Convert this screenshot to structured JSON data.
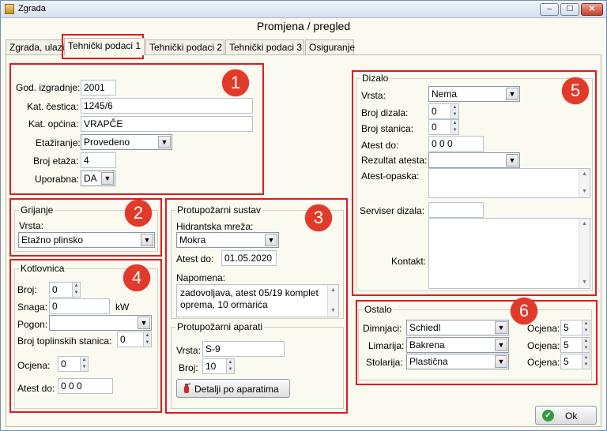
{
  "window": {
    "title": "Zgrada",
    "min": "‒",
    "max": "☐",
    "close": "✕"
  },
  "header": {
    "title": "Promjena / pregled"
  },
  "tabs": [
    "Zgrada, ulazi",
    "Tehnički podaci 1",
    "Tehnički podaci 2",
    "Tehnički podaci 3",
    "Osiguranje"
  ],
  "badges": [
    "1",
    "2",
    "3",
    "4",
    "5",
    "6"
  ],
  "section1": {
    "god_izgradnje_label": "God. izgradnje:",
    "god_izgradnje": "2001",
    "kat_cestica_label": "Kat. čestica:",
    "kat_cestica": "1245/6",
    "kat_opcina_label": "Kat. općina:",
    "kat_opcina": "VRAPČE",
    "etaziranje_label": "Etažiranje:",
    "etaziranje": "Provedeno",
    "broj_etaza_label": "Broj etaža:",
    "broj_etaza": "4",
    "uporabna_label": "Uporabna:",
    "uporabna": "DA"
  },
  "grijanje": {
    "title": "Grijanje",
    "vrsta_label": "Vrsta:",
    "vrsta": "Etažno plinsko"
  },
  "kotlovnica": {
    "title": "Kotlovnica",
    "broj_label": "Broj:",
    "broj": "0",
    "snaga_label": "Snaga:",
    "snaga": "0",
    "snaga_unit": "kW",
    "pogon_label": "Pogon:",
    "pogon": "",
    "broj_stanica_label": "Broj toplinskih stanica:",
    "broj_stanica": "0",
    "ocjena_label": "Ocjena:",
    "ocjena": "0",
    "atest_label": "Atest do:",
    "atest": "0 0 0"
  },
  "protupozarni": {
    "title": "Protupožarni sustav",
    "hidrantska_label": "Hidrantska mreža:",
    "hidrantska": "Mokra",
    "atest_label": "Atest do:",
    "atest": "01.05.2020",
    "napomena_label": "Napomena:",
    "napomena": "zadovoljava, atest 05/19 komplet oprema, 10 ormarića",
    "aparati_title": "Protupožarni aparati",
    "vrsta_label": "Vrsta:",
    "vrsta": "S-9",
    "broj_label": "Broj:",
    "broj": "10",
    "detalji_button": "Detalji po aparatima"
  },
  "dizalo": {
    "title": "Dizalo",
    "vrsta_label": "Vrsta:",
    "vrsta": "Nema",
    "broj_dizala_label": "Broj dizala:",
    "broj_dizala": "0",
    "broj_stanica_label": "Broj stanica:",
    "broj_stanica": "0",
    "atest_label": "Atest do:",
    "atest": "0 0 0",
    "rezultat_label": "Rezultat atesta:",
    "rezultat": "",
    "atest_opaska_label": "Atest-opaska:",
    "atest_opaska": "",
    "serviser_label": "Serviser dizala:",
    "serviser": "",
    "kontakt_label": "Kontakt:",
    "kontakt": ""
  },
  "ostalo": {
    "title": "Ostalo",
    "dimnjaci_label": "Dimnjaci:",
    "dimnjaci": "Schiedl",
    "dimnjaci_ocjena": "5",
    "limarija_label": "Limarija:",
    "limarija": "Bakrena",
    "limarija_ocjena": "5",
    "stolarija_label": "Stolarija:",
    "stolarija": "Plastična",
    "stolarija_ocjena": "5",
    "ocjena_label": "Ocjena:"
  },
  "ok_button": "Ok",
  "colors": {
    "highlight": "#e11b1b",
    "badge": "#e23a2a",
    "background": "#fafaf0"
  }
}
